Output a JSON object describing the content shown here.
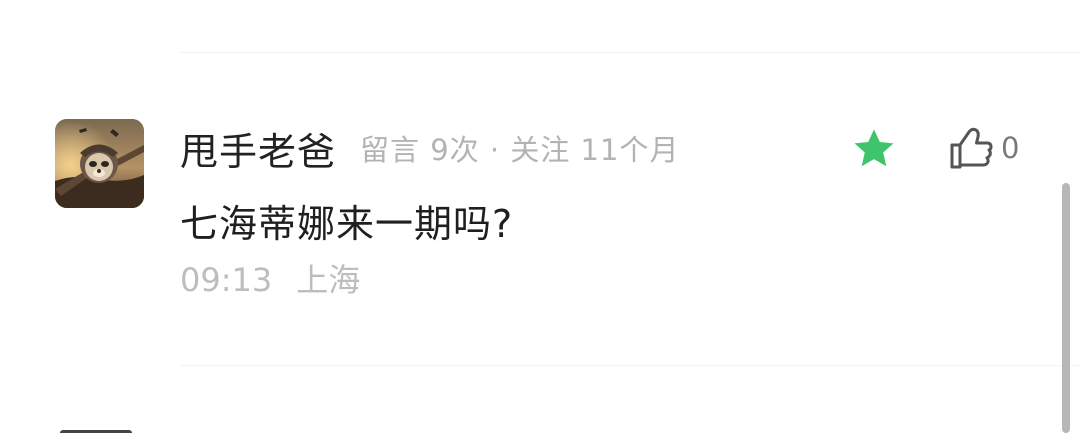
{
  "comment": {
    "author": "甩手老爸",
    "meta": "留言 9次 · 关注 11个月",
    "text": "七海蒂娜来一期吗?",
    "time": "09:13",
    "location": "上海",
    "like_count": "0"
  },
  "icons": {
    "avatar": "avatar-image",
    "star": "star-icon",
    "like": "thumbs-up-icon"
  },
  "colors": {
    "star": "#3fc46b",
    "author_text": "#222222",
    "meta_text": "#b3b3b3",
    "footer_text": "#bdbdbd"
  }
}
